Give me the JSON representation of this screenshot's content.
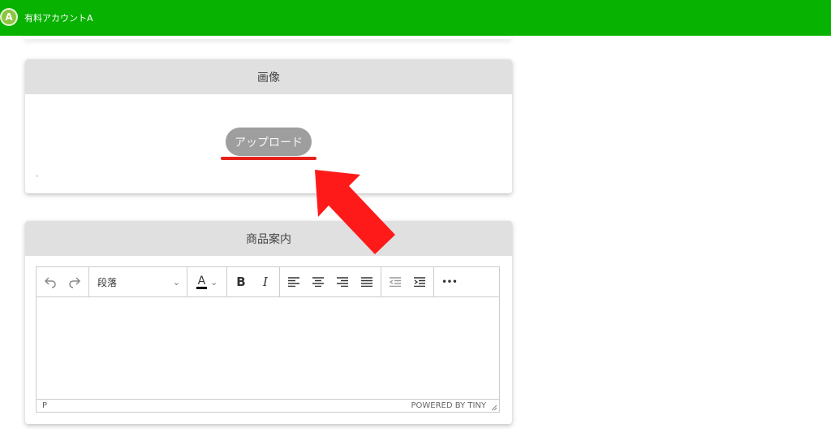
{
  "header": {
    "avatar_letter": "A",
    "account_name": "有料アカウントA",
    "bg_color": "#07b200"
  },
  "image_section": {
    "title": "画像",
    "upload_button": "アップロード",
    "highlight_color": "#e8201c"
  },
  "description_section": {
    "title": "商品案内",
    "editor": {
      "toolbar": {
        "undo_icon": "undo-icon",
        "redo_icon": "redo-icon",
        "block_format": "段落",
        "font_color_letter": "A",
        "bold_letter": "B",
        "italic_letter": "I",
        "align_icons": [
          "align-left-icon",
          "align-center-icon",
          "align-right-icon",
          "align-justify-icon"
        ],
        "indent_icons": [
          "outdent-icon",
          "indent-icon"
        ],
        "more": "•••"
      },
      "content": "",
      "status_path": "P",
      "branding": "POWERED BY TINY"
    }
  },
  "annotation": {
    "arrow_color": "#ff1a1a",
    "arrow_icon": "red-pointer-arrow"
  }
}
